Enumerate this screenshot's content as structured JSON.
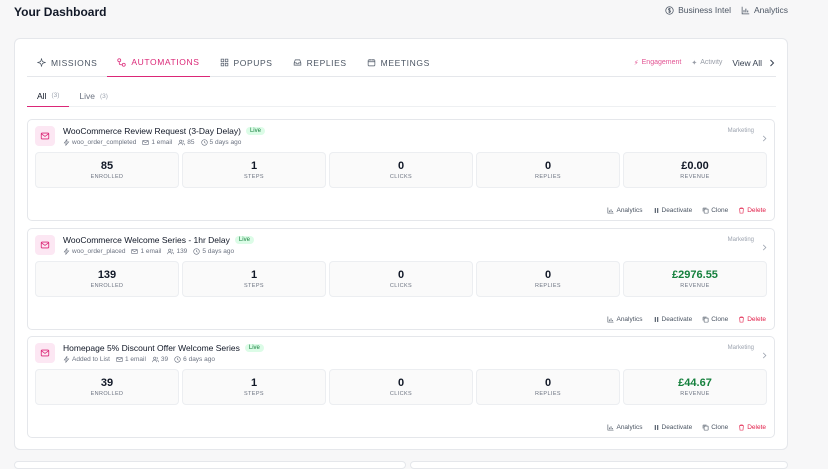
{
  "header": {
    "title": "Your Dashboard",
    "links": [
      "Business Intel",
      "Analytics"
    ]
  },
  "tabs": {
    "items": [
      "MISSIONS",
      "AUTOMATIONS",
      "POPUPS",
      "REPLIES",
      "MEETINGS"
    ],
    "right": {
      "engagement": "Engagement",
      "activity": "Activity",
      "view_all": "View All"
    }
  },
  "subtabs": [
    {
      "label": "All",
      "count": "(3)"
    },
    {
      "label": "Live",
      "count": "(3)"
    }
  ],
  "card_actions": {
    "analytics": "Analytics",
    "deactivate": "Deactivate",
    "clone": "Clone",
    "delete": "Delete"
  },
  "stat_labels": [
    "ENROLLED",
    "STEPS",
    "CLICKS",
    "REPLIES",
    "REVENUE"
  ],
  "automations": [
    {
      "title": "WooCommerce Review Request (3-Day Delay)",
      "status": "Live",
      "trigger": "woo_order_completed",
      "emails": "1 email",
      "people": "85",
      "age": "5 days ago",
      "category": "Marketing",
      "stats": [
        "85",
        "1",
        "0",
        "0",
        "£0.00"
      ]
    },
    {
      "title": "WooCommerce Welcome Series - 1hr Delay",
      "status": "Live",
      "trigger": "woo_order_placed",
      "emails": "1 email",
      "people": "139",
      "age": "5 days ago",
      "category": "Marketing",
      "stats": [
        "139",
        "1",
        "0",
        "0",
        "£2976.55"
      ]
    },
    {
      "title": "Homepage 5% Discount Offer Welcome Series",
      "status": "Live",
      "trigger": "Added to List",
      "emails": "1 email",
      "people": "39",
      "age": "6 days ago",
      "category": "Marketing",
      "stats": [
        "39",
        "1",
        "0",
        "0",
        "£44.67"
      ]
    }
  ],
  "colors": {
    "accent": "#db2777",
    "live": "#15803d",
    "revenue": "#15803d",
    "delete": "#e11d48"
  }
}
